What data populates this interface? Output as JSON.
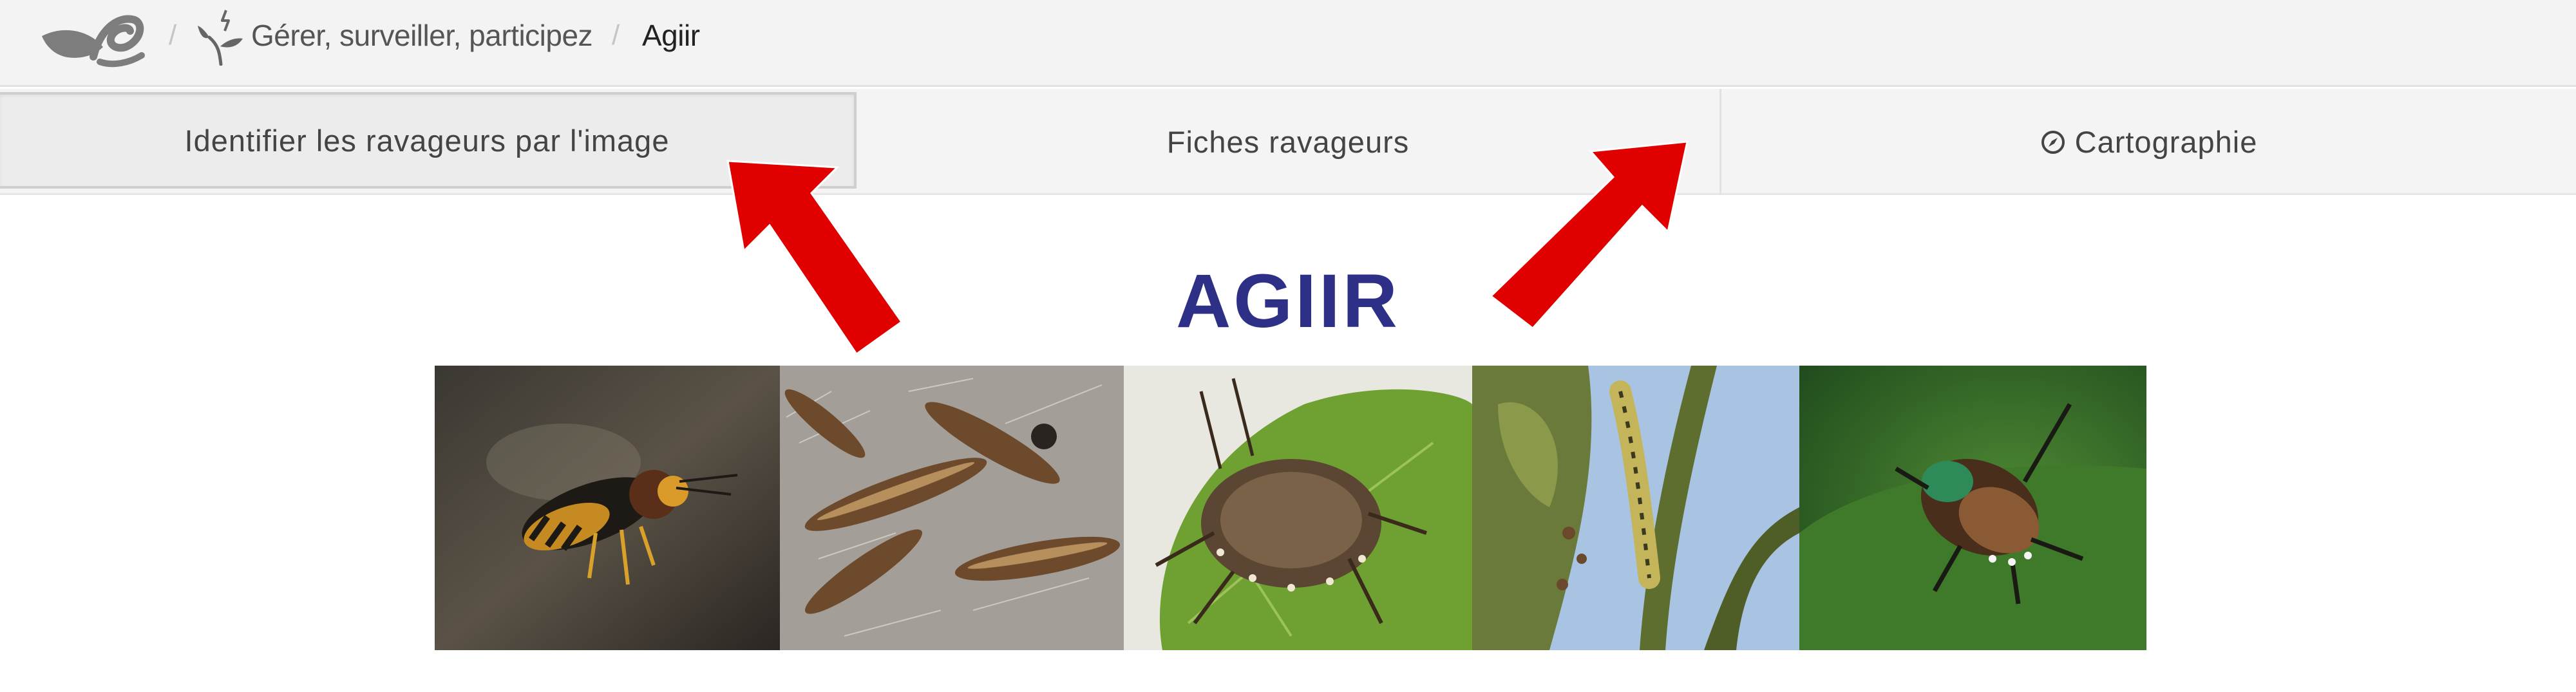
{
  "breadcrumb": {
    "separator": "/",
    "link_label": "Gérer, surveiller, participez",
    "current_label": "Agiir"
  },
  "tabs": [
    {
      "label": "Identifier les ravageurs par l'image",
      "active": true
    },
    {
      "label": "Fiches ravageurs",
      "active": false
    },
    {
      "label": "Cartographie",
      "active": false,
      "icon": "compass-icon"
    }
  ],
  "page": {
    "title": "AGIIR"
  },
  "banner": {
    "photos": [
      "hornet",
      "processionary-caterpillars",
      "stink-bug",
      "caterpillar-on-plant",
      "japanese-beetle"
    ]
  },
  "colors": {
    "title": "#2e2f86",
    "arrow": "#e00000",
    "tab_bg": "#f4f4f4"
  }
}
